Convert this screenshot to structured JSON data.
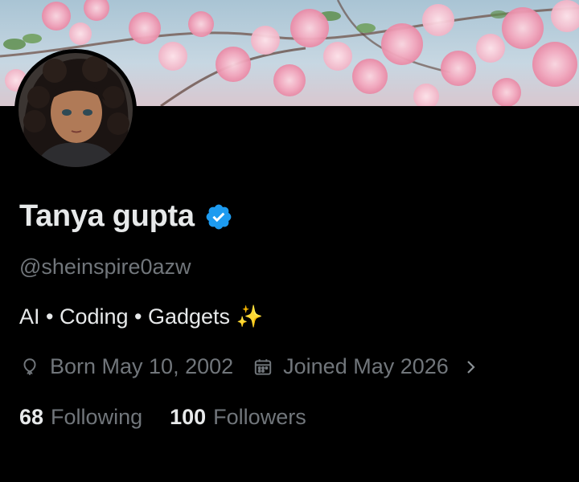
{
  "profile": {
    "name": "Tanya gupta",
    "handle": "@sheinspire0azw",
    "bio": "AI • Coding • Gadgets ✨",
    "verified": true,
    "verified_color": "#1d9bf0"
  },
  "meta": {
    "birthday_icon": "balloon-icon",
    "birthday_text": "Born May 10, 2002",
    "joined_icon": "calendar-icon",
    "joined_text": "Joined May 2026",
    "more_icon": "chevron-right-icon"
  },
  "stats": {
    "following_count": "68",
    "following_label": "Following",
    "followers_count": "100",
    "followers_label": "Followers"
  },
  "colors": {
    "background": "#000000",
    "primary_text": "#e7e9ea",
    "secondary_text": "#71767b",
    "banner_blossom": "#f4a7bd"
  }
}
